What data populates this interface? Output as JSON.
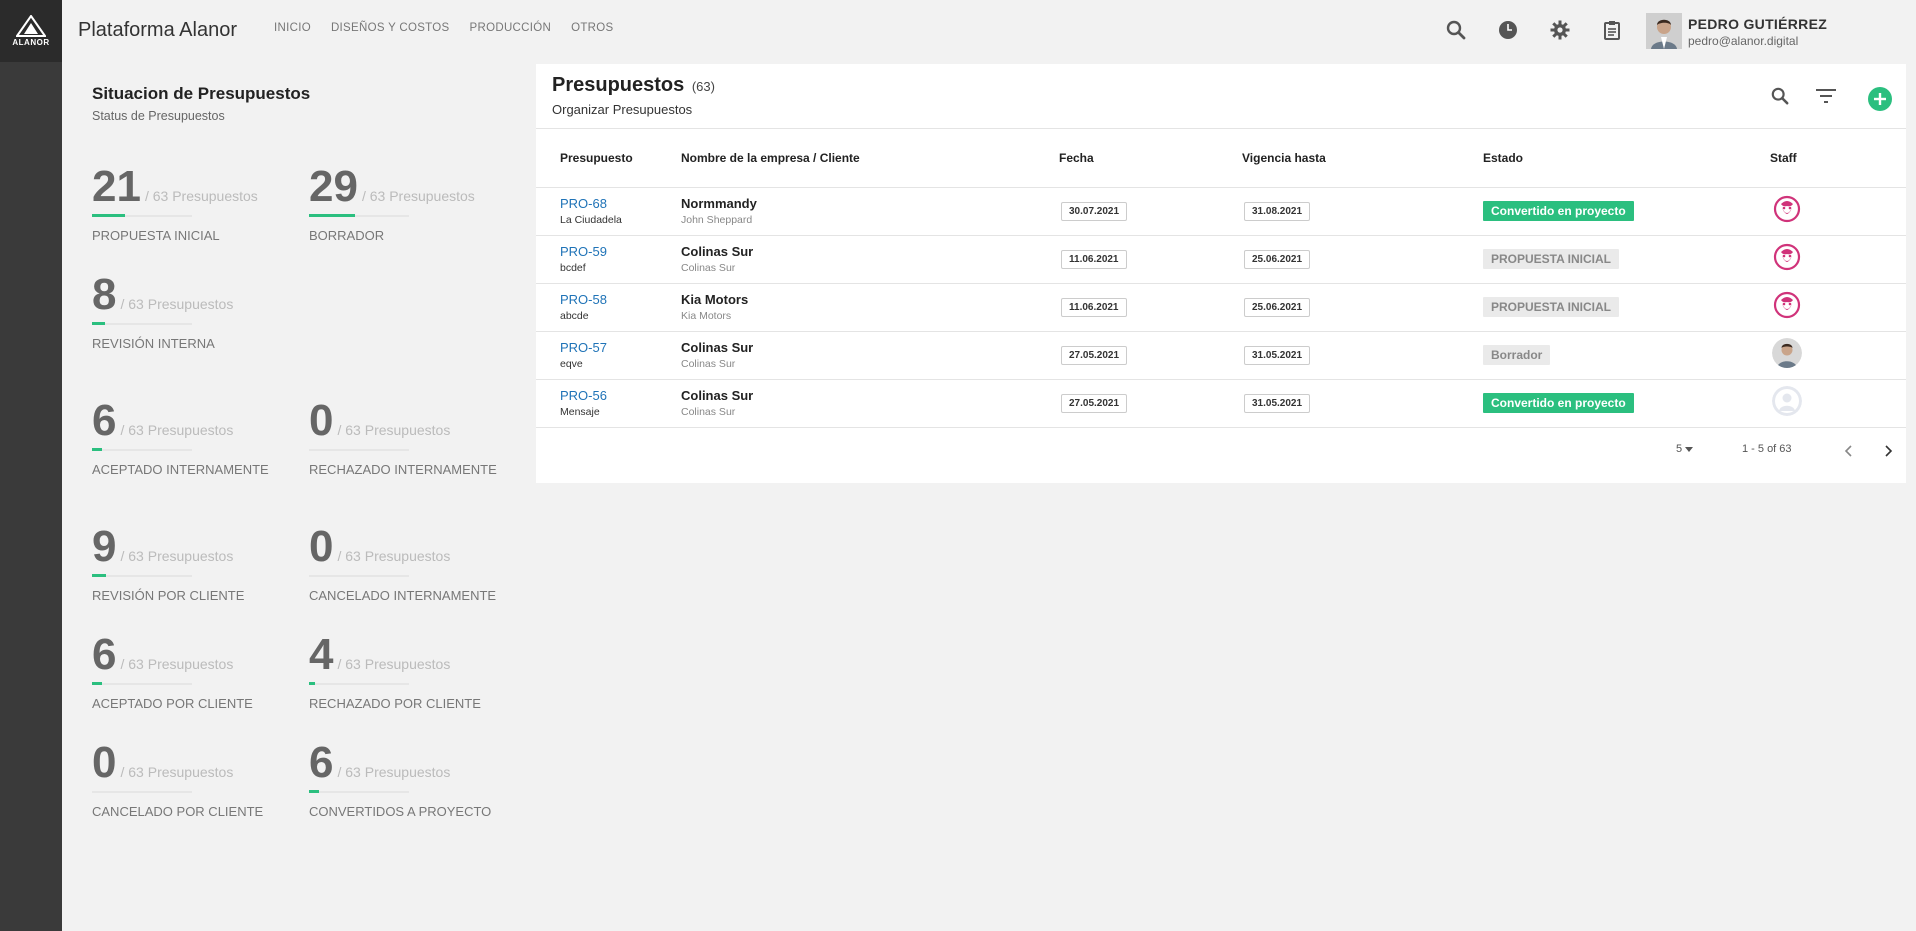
{
  "brand": {
    "logo_text": "ALANOR",
    "app_title": "Plataforma Alanor",
    "accent": "#2bbf7f"
  },
  "nav": [
    "INICIO",
    "DISEÑOS Y COSTOS",
    "PRODUCCIÓN",
    "OTROS"
  ],
  "top_icons": [
    "search-icon",
    "clock-icon",
    "gear-icon",
    "clipboard-icon",
    "bell-icon"
  ],
  "user": {
    "name": "PEDRO GUTIÉRREZ",
    "email": "pedro@alanor.digital"
  },
  "summary": {
    "title": "Situacion de Presupuestos",
    "subtitle": "Status de Presupuestos",
    "stats": [
      {
        "value": "21",
        "total": "/ 63 Presupuestos",
        "label": "PROPUESTA INICIAL",
        "fraction": 0.333
      },
      {
        "value": "29",
        "total": "/ 63 Presupuestos",
        "label": "BORRADOR",
        "fraction": 0.46
      },
      {
        "value": "8",
        "total": "/ 63 Presupuestos",
        "label": "REVISIÓN INTERNA",
        "fraction": 0.127
      },
      {
        "value": "0",
        "total": "/ 63 Presupuestos",
        "label": "RECHAZADO INTERNAMENTE",
        "fraction": 0
      },
      {
        "value": "6",
        "total": "/ 63 Presupuestos",
        "label": "ACEPTADO INTERNAMENTE",
        "fraction": 0.095
      },
      {
        "value": "0",
        "total": "/ 63 Presupuestos",
        "label": "CANCELADO INTERNAMENTE",
        "fraction": 0
      },
      {
        "value": "9",
        "total": "/ 63 Presupuestos",
        "label": "REVISIÓN POR CLIENTE",
        "fraction": 0.143
      },
      {
        "value": "4",
        "total": "/ 63 Presupuestos",
        "label": "RECHAZADO POR CLIENTE",
        "fraction": 0.063
      },
      {
        "value": "6",
        "total": "/ 63 Presupuestos",
        "label": "ACEPTADO POR CLIENTE",
        "fraction": 0.095
      },
      {
        "value": "6",
        "total": "/ 63 Presupuestos",
        "label": "CONVERTIDOS A PROYECTO",
        "fraction": 0.095
      },
      {
        "value": "0",
        "total": "/ 63 Presupuestos",
        "label": "CANCELADO POR CLIENTE",
        "fraction": 0
      }
    ]
  },
  "budgets": {
    "title": "Presupuestos",
    "count": "(63)",
    "subtitle": "Organizar Presupuestos",
    "columns": [
      "Presupuesto",
      "Nombre de la empresa / Cliente",
      "Fecha",
      "Vigencia hasta",
      "Estado",
      "Staff"
    ],
    "rows": [
      {
        "code": "PRO-68",
        "name": "La Ciudadela",
        "company": "Normmandy",
        "client": "John Sheppard",
        "date": "30.07.2021",
        "valid_until": "31.08.2021",
        "status": "Convertido en proyecto",
        "status_type": "green",
        "staff": "logo"
      },
      {
        "code": "PRO-59",
        "name": "bcdef",
        "company": "Colinas Sur",
        "client": "Colinas Sur",
        "date": "11.06.2021",
        "valid_until": "25.06.2021",
        "status": "PROPUESTA INICIAL",
        "status_type": "grey",
        "staff": "logo"
      },
      {
        "code": "PRO-58",
        "name": "abcde",
        "company": "Kia Motors",
        "client": "Kia Motors",
        "date": "11.06.2021",
        "valid_until": "25.06.2021",
        "status": "PROPUESTA INICIAL",
        "status_type": "grey",
        "staff": "logo"
      },
      {
        "code": "PRO-57",
        "name": "eqve",
        "company": "Colinas Sur",
        "client": "Colinas Sur",
        "date": "27.05.2021",
        "valid_until": "31.05.2021",
        "status": "Borrador",
        "status_type": "grey",
        "staff": "photo"
      },
      {
        "code": "PRO-56",
        "name": "Mensaje",
        "company": "Colinas Sur",
        "client": "Colinas Sur",
        "date": "27.05.2021",
        "valid_until": "31.05.2021",
        "status": "Convertido en proyecto",
        "status_type": "green",
        "staff": "placeholder"
      }
    ],
    "pagination": {
      "page_size": "5",
      "range": "1 - 5 of 63"
    }
  }
}
